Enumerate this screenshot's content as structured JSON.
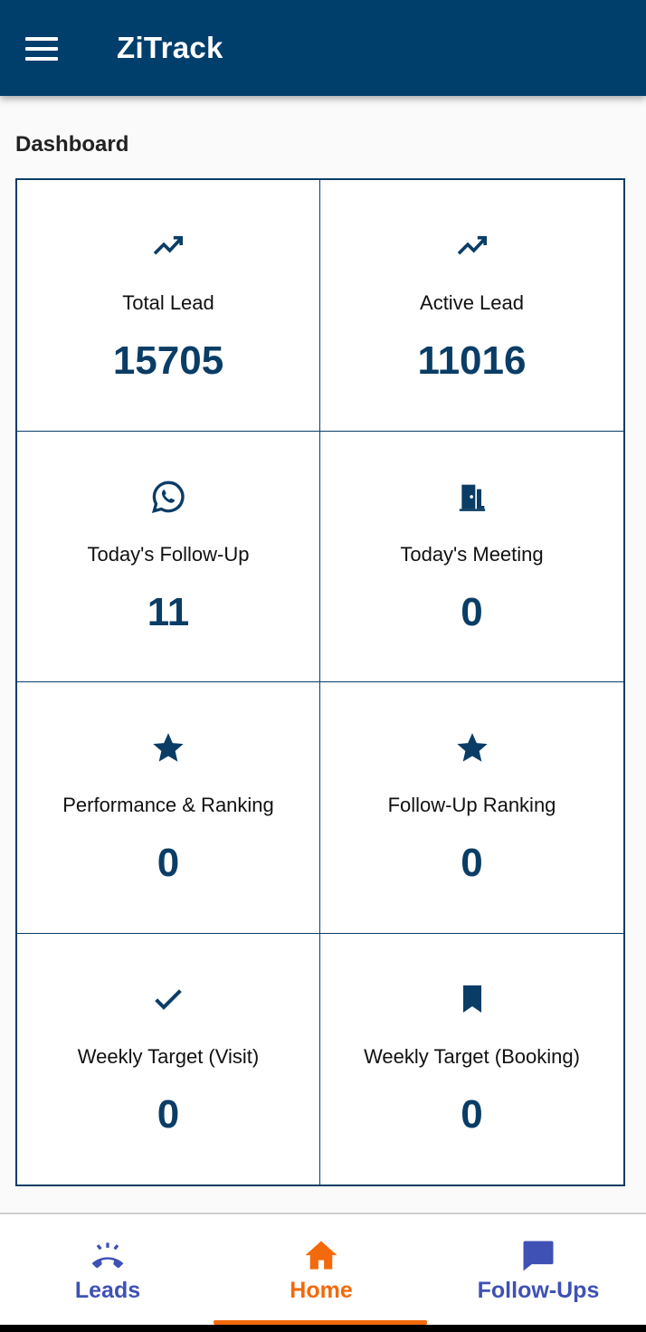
{
  "app": {
    "title": "ZiTrack",
    "primary_color": "#003e6c",
    "accent_color": "#f26a0b",
    "nav_inactive_color": "#3f51b5"
  },
  "page": {
    "section_title": "Dashboard"
  },
  "cards": [
    {
      "icon": "trending-up-icon",
      "label": "Total Lead",
      "value": "15705"
    },
    {
      "icon": "trending-up-icon",
      "label": "Active Lead",
      "value": "11016"
    },
    {
      "icon": "whatsapp-icon",
      "label": "Today's Follow-Up",
      "value": "11"
    },
    {
      "icon": "meeting-room-icon",
      "label": "Today's Meeting",
      "value": "0"
    },
    {
      "icon": "star-icon",
      "label": "Performance & Ranking",
      "value": "0"
    },
    {
      "icon": "star-icon",
      "label": "Follow-Up Ranking",
      "value": "0"
    },
    {
      "icon": "check-icon",
      "label": "Weekly Target (Visit)",
      "value": "0"
    },
    {
      "icon": "bookmark-icon",
      "label": "Weekly Target (Booking)",
      "value": "0"
    }
  ],
  "bottom_nav": {
    "active": "Home",
    "items": [
      {
        "icon": "phone-ringing-icon",
        "label": "Leads"
      },
      {
        "icon": "home-icon",
        "label": "Home"
      },
      {
        "icon": "chat-icon",
        "label": "Follow-Ups"
      }
    ]
  }
}
